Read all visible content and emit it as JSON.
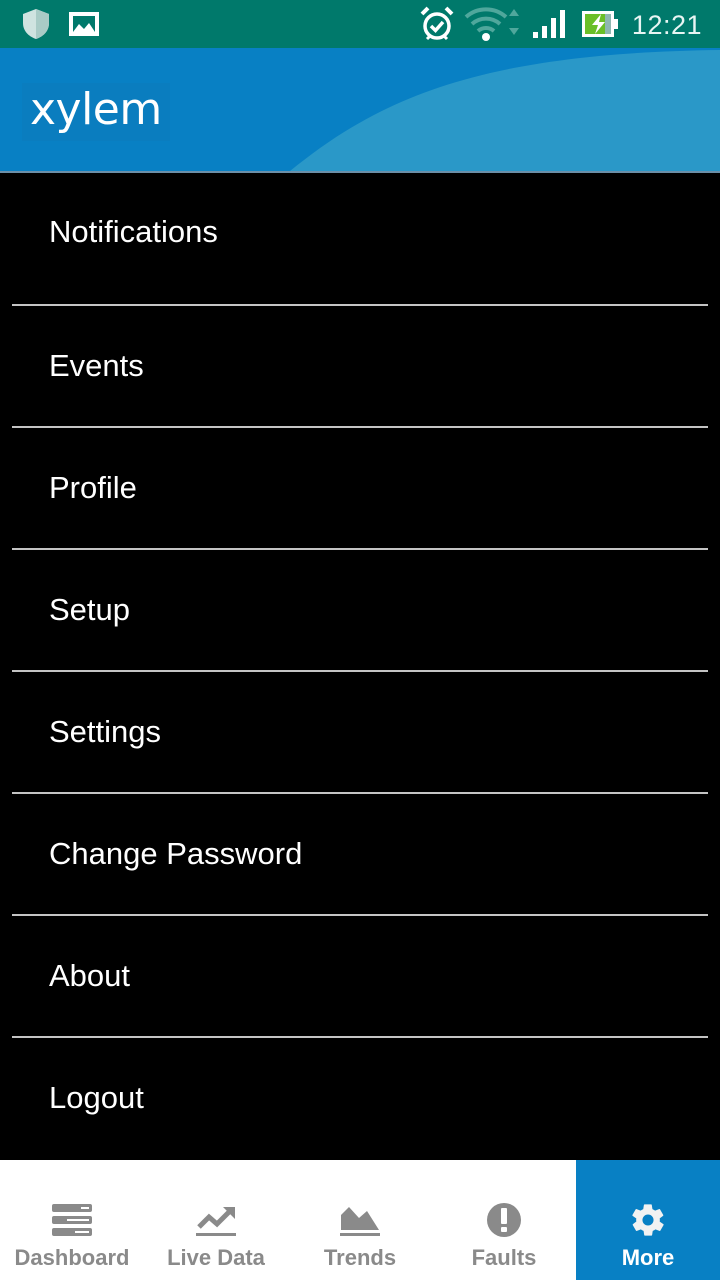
{
  "status_bar": {
    "time": "12:21",
    "icons": [
      "shield-icon",
      "image-icon",
      "alarm-icon",
      "wifi-icon",
      "signal-icon",
      "battery-charging-icon"
    ]
  },
  "header": {
    "logo_text": "xylem"
  },
  "menu": {
    "items": [
      {
        "label": "Notifications"
      },
      {
        "label": "Events"
      },
      {
        "label": "Profile"
      },
      {
        "label": "Setup"
      },
      {
        "label": "Settings"
      },
      {
        "label": "Change Password"
      },
      {
        "label": "About"
      },
      {
        "label": "Logout"
      }
    ]
  },
  "bottom_nav": {
    "tabs": [
      {
        "label": "Dashboard",
        "icon": "dashboard-icon",
        "active": false
      },
      {
        "label": "Live Data",
        "icon": "trending-up-icon",
        "active": false
      },
      {
        "label": "Trends",
        "icon": "area-chart-icon",
        "active": false
      },
      {
        "label": "Faults",
        "icon": "alert-circle-icon",
        "active": false
      },
      {
        "label": "More",
        "icon": "gear-icon",
        "active": true
      }
    ],
    "active_color": "#0880c4",
    "inactive_color": "#8a8a8a"
  }
}
